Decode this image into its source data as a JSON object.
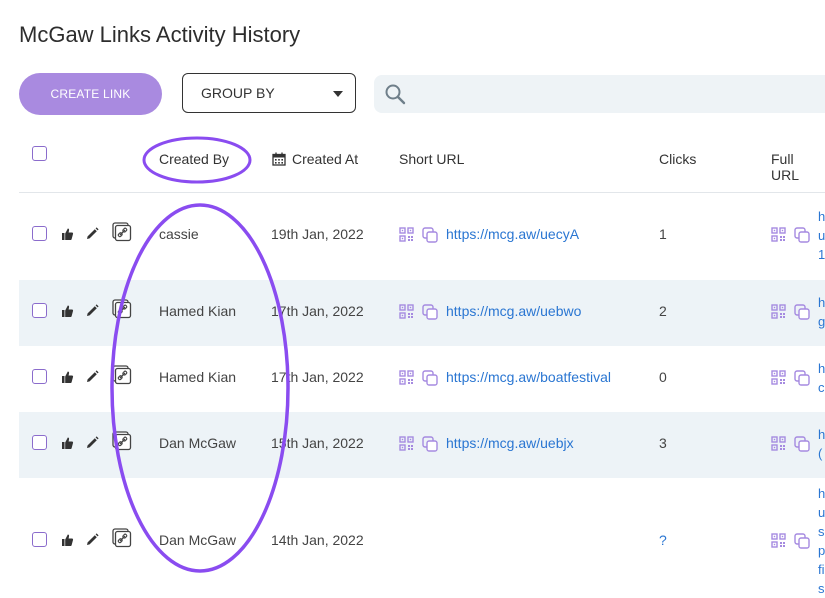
{
  "page": {
    "title": "McGaw Links Activity History"
  },
  "toolbar": {
    "create_label": "CREATE LINK",
    "group_by_label": "GROUP BY",
    "search_placeholder": ""
  },
  "columns": [
    "Created By",
    "Created At",
    "Short URL",
    "Clicks",
    "Full URL"
  ],
  "rows": [
    {
      "created_by": "cassie",
      "created_at": "19th Jan, 2022",
      "short_url": "https://mcg.aw/uecyA",
      "clicks": "1",
      "full_url": [
        "h",
        "u",
        "1!"
      ]
    },
    {
      "created_by": "Hamed Kian",
      "created_at": "17th Jan, 2022",
      "short_url": "https://mcg.aw/uebwo",
      "clicks": "2",
      "full_url": [
        "h",
        "g"
      ]
    },
    {
      "created_by": "Hamed Kian",
      "created_at": "17th Jan, 2022",
      "short_url": "https://mcg.aw/boatfestival",
      "clicks": "0",
      "full_url": [
        "h",
        "c"
      ]
    },
    {
      "created_by": "Dan McGaw",
      "created_at": "15th Jan, 2022",
      "short_url": "https://mcg.aw/uebjx",
      "clicks": "3",
      "full_url": [
        "h",
        "("
      ]
    },
    {
      "created_by": "Dan McGaw",
      "created_at": "14th Jan, 2022",
      "short_url": "",
      "clicks": "?",
      "full_url": [
        "h",
        "u",
        "s",
        "p",
        "fi",
        "s"
      ]
    }
  ],
  "colors": {
    "accent": "#a98ae0",
    "link": "#2a76d2",
    "annotation": "#8a4cf0",
    "row_alt": "#edf3f7"
  },
  "icons": [
    "search-icon",
    "calendar-icon",
    "thumbs-up-icon",
    "pencil-icon",
    "link-icon",
    "qr-code-icon",
    "copy-icon",
    "caret-down-icon"
  ]
}
